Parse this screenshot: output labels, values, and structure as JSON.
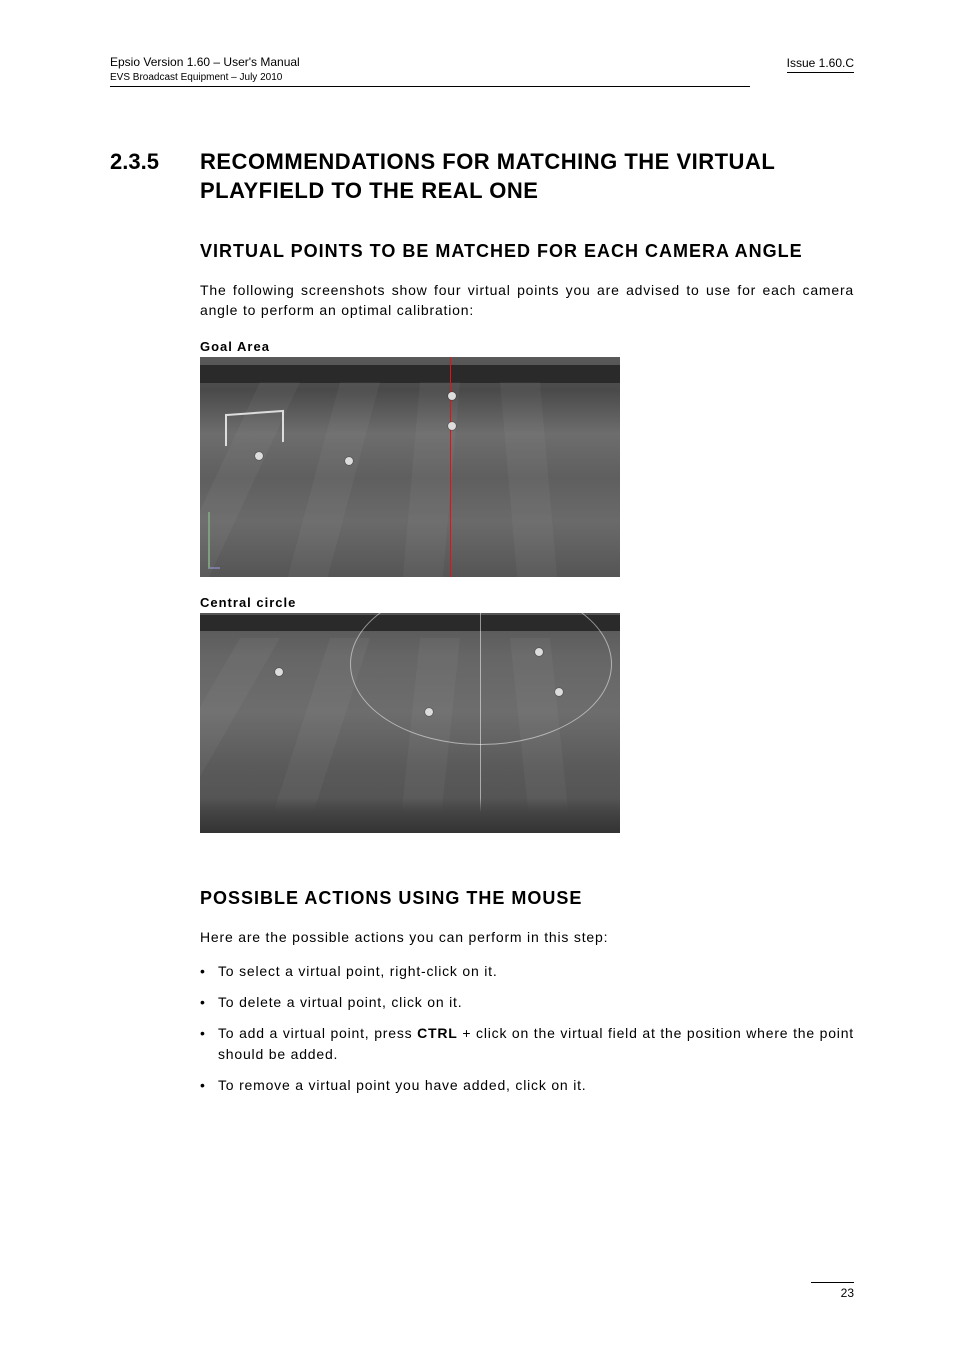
{
  "header": {
    "left_line1": "Epsio Version 1.60 – User's Manual",
    "left_line2": "EVS Broadcast Equipment – July 2010",
    "right": "Issue 1.60.C"
  },
  "section": {
    "number": "2.3.5",
    "title_line1": "RECOMMENDATIONS FOR MATCHING THE VIRTUAL",
    "title_line2": "PLAYFIELD TO THE REAL ONE"
  },
  "sub1": {
    "title": "VIRTUAL POINTS TO BE MATCHED FOR EACH CAMERA ANGLE",
    "intro": "The following screenshots show four virtual points you are advised to use for each camera angle to perform an optimal calibration:",
    "caption1": "Goal Area",
    "caption2": "Central circle"
  },
  "sub2": {
    "title": "POSSIBLE ACTIONS USING THE MOUSE",
    "intro": "Here are the possible actions you can perform in this step:",
    "items": [
      {
        "text": "To select a virtual point, right-click on it."
      },
      {
        "text": "To delete a virtual point, click on it."
      },
      {
        "pre": "To add a virtual point, press ",
        "bold": "CTRL",
        "post": " + click on the virtual field at the position where the point should be added."
      },
      {
        "text": "To remove a virtual point you have added, click on it."
      }
    ]
  },
  "page_number": "23"
}
